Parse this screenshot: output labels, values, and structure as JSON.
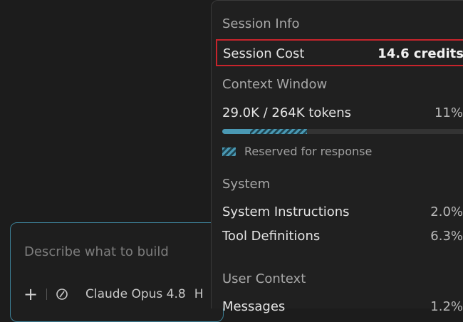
{
  "composer": {
    "placeholder": "Describe what to build",
    "add_icon": "+",
    "model_label": "Claude Opus 4.8",
    "truncated_label": "H"
  },
  "session_info": {
    "title": "Session Info",
    "cost_label": "Session Cost",
    "cost_value": "14.6 credits",
    "context_window": {
      "title": "Context Window",
      "tokens_label": "29.0K / 264K tokens",
      "percent_label": "11%",
      "used_fraction": 0.11,
      "reserved_fraction": 0.23,
      "reserved_legend": "Reserved for response"
    },
    "system": {
      "title": "System",
      "rows": [
        {
          "label": "System Instructions",
          "value": "2.0%"
        },
        {
          "label": "Tool Definitions",
          "value": "6.3%"
        }
      ]
    },
    "user_context": {
      "title": "User Context",
      "rows": [
        {
          "label": "Messages",
          "value": "1.2%"
        }
      ]
    }
  },
  "colors": {
    "accent": "#4a98b3",
    "highlight_border": "#c8242c",
    "composer_border": "#3c7f96"
  }
}
